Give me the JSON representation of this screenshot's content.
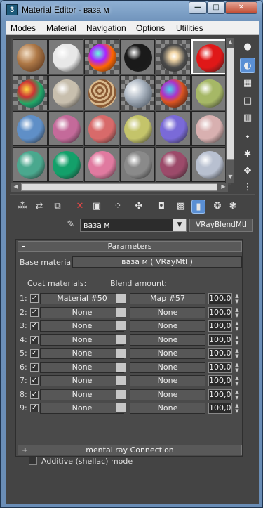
{
  "window": {
    "title": "Material Editor - ваза м",
    "app_icon": "3",
    "controls": {
      "minimize": "—",
      "maximize": "□",
      "close": "✕"
    }
  },
  "menu": [
    "Modes",
    "Material",
    "Navigation",
    "Options",
    "Utilities"
  ],
  "slots": [
    {
      "name": "slot-1",
      "type": "wood-tex"
    },
    {
      "name": "slot-2",
      "color": "#e8e8e8"
    },
    {
      "name": "slot-3",
      "type": "multicolor"
    },
    {
      "name": "slot-4",
      "color": "#1a1a1a"
    },
    {
      "name": "slot-5",
      "type": "glow"
    },
    {
      "name": "slot-6",
      "color": "#e01818",
      "active": true
    },
    {
      "name": "slot-7",
      "type": "multicolor2"
    },
    {
      "name": "slot-8",
      "color": "#c8bfae"
    },
    {
      "name": "slot-9",
      "type": "wood2"
    },
    {
      "name": "slot-10",
      "type": "noise"
    },
    {
      "name": "slot-11",
      "type": "dark-multi"
    },
    {
      "name": "slot-12",
      "color": "#a6b866"
    },
    {
      "name": "slot-13",
      "color": "#5f8fc7"
    },
    {
      "name": "slot-14",
      "color": "#c46a9a"
    },
    {
      "name": "slot-15",
      "color": "#d86a6a"
    },
    {
      "name": "slot-16",
      "color": "#c4c46a"
    },
    {
      "name": "slot-17",
      "color": "#7a6ad8"
    },
    {
      "name": "slot-18",
      "color": "#d8b0b0"
    },
    {
      "name": "slot-19",
      "color": "#4aa88e"
    },
    {
      "name": "slot-20",
      "color": "#13a06a"
    },
    {
      "name": "slot-21",
      "color": "#e07aa0"
    },
    {
      "name": "slot-22",
      "color": "#8a8a8a"
    },
    {
      "name": "slot-23",
      "color": "#9c4a6a"
    },
    {
      "name": "slot-24",
      "color": "#b8c0d0"
    }
  ],
  "side_tools": [
    "sample-type-icon",
    "backlight-icon",
    "background-icon",
    "uv-tiling-icon",
    "video-color-icon",
    "make-preview-icon",
    "options-icon",
    "select-by-material-icon",
    "material-map-navigator-icon"
  ],
  "toolbar": [
    "get-material-icon",
    "put-to-scene-icon",
    "assign-to-selection-icon",
    "reset-map-icon",
    "make-copy-icon",
    "make-unique-icon",
    "put-to-library-icon",
    "material-id-channel-icon",
    "show-map-icon",
    "show-end-result-icon",
    "go-to-parent-icon",
    "go-forward-icon"
  ],
  "material_name": "ваза м",
  "material_type": "VRayBlendMtl",
  "parameters": {
    "header": "Parameters",
    "collapse_sign": "-",
    "base_material_label": "Base material:",
    "base_material_value": "ваза м  ( VRayMtl )",
    "coat_label": "Coat materials:",
    "blend_label": "Blend amount:",
    "rows": [
      {
        "num": "1:",
        "checked": true,
        "coat": "Material #50",
        "blend": "Map #57",
        "amount": "100,0"
      },
      {
        "num": "2:",
        "checked": true,
        "coat": "None",
        "blend": "None",
        "amount": "100,0"
      },
      {
        "num": "3:",
        "checked": true,
        "coat": "None",
        "blend": "None",
        "amount": "100,0"
      },
      {
        "num": "4:",
        "checked": true,
        "coat": "None",
        "blend": "None",
        "amount": "100,0"
      },
      {
        "num": "5:",
        "checked": true,
        "coat": "None",
        "blend": "None",
        "amount": "100,0"
      },
      {
        "num": "6:",
        "checked": true,
        "coat": "None",
        "blend": "None",
        "amount": "100,0"
      },
      {
        "num": "7:",
        "checked": true,
        "coat": "None",
        "blend": "None",
        "amount": "100,0"
      },
      {
        "num": "8:",
        "checked": true,
        "coat": "None",
        "blend": "None",
        "amount": "100,0"
      },
      {
        "num": "9:",
        "checked": true,
        "coat": "None",
        "blend": "None",
        "amount": "100,0"
      }
    ],
    "additive_label": "Additive (shellac) mode"
  },
  "mental_ray": {
    "header": "mental ray Connection",
    "expand_sign": "+"
  }
}
